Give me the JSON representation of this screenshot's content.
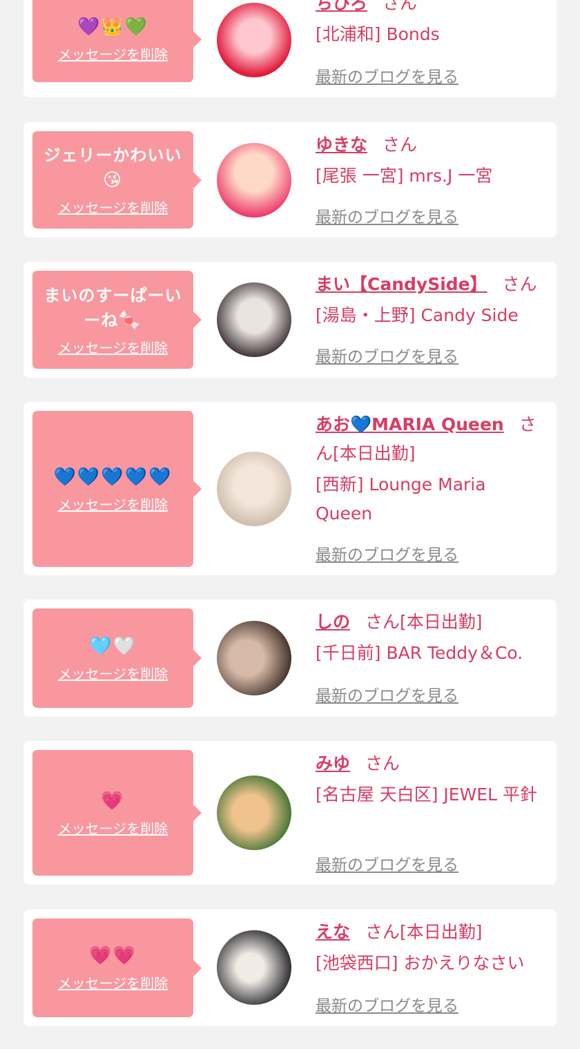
{
  "cards": [
    {
      "message": "",
      "emoji": "💜👑💚",
      "delete_label": "メッセージを削除",
      "name": "ちひろ",
      "san": "さん",
      "attendance": "",
      "shop": "[北浦和] Bonds",
      "blog_label": "最新のブログを見る",
      "avatar_colors": [
        "#ffc7cf",
        "#e01b3c"
      ]
    },
    {
      "message": "ジェリーかわいい",
      "emoji": "😘",
      "delete_label": "メッセージを削除",
      "name": "ゆきな",
      "san": "さん",
      "attendance": "",
      "shop": "[尾張 一宮] mrs.J 一宮",
      "blog_label": "最新のブログを見る",
      "avatar_colors": [
        "#ffd9c8",
        "#ec3a6a"
      ]
    },
    {
      "message": "まいのすーぱーいーね",
      "emoji": "🍬",
      "delete_label": "メッセージを削除",
      "name": "まい【CandySide】",
      "san": "さん",
      "attendance": "",
      "shop": "[湯島・上野] Candy Side",
      "blog_label": "最新のブログを見る",
      "avatar_colors": [
        "#e9e4e0",
        "#3b2f33"
      ]
    },
    {
      "message": "",
      "emoji": "💙💙💙💙💙",
      "delete_label": "メッセージを削除",
      "name": "あお💙MARIA Queen",
      "san": "さん",
      "attendance": "[本日出勤]",
      "shop": "[西新] Lounge Maria Queen",
      "blog_label": "最新のブログを見る",
      "avatar_colors": [
        "#f4e6da",
        "#c8b6a6"
      ]
    },
    {
      "message": "",
      "emoji": "🩵🤍",
      "delete_label": "メッセージを削除",
      "name": "しの",
      "san": "さん",
      "attendance": "[本日出勤]",
      "shop": "[千日前] BAR Teddy＆Co.",
      "blog_label": "最新のブログを見る",
      "avatar_colors": [
        "#d6b9a8",
        "#3a2a22"
      ]
    },
    {
      "message": "",
      "emoji": "💗",
      "delete_label": "メッセージを削除",
      "name": "みゆ",
      "san": "さん",
      "attendance": "",
      "shop": "[名古屋 天白区] JEWEL 平針",
      "blog_label": "最新のブログを見る",
      "avatar_colors": [
        "#f0c38e",
        "#2e6b2a"
      ]
    },
    {
      "message": "",
      "emoji": "💗💗",
      "delete_label": "メッセージを削除",
      "name": "えな",
      "san": "さん",
      "attendance": "[本日出勤]",
      "shop": "[池袋西口] おかえりなさい",
      "blog_label": "最新のブログを見る",
      "avatar_colors": [
        "#f1ebe6",
        "#2b2b30"
      ]
    }
  ]
}
